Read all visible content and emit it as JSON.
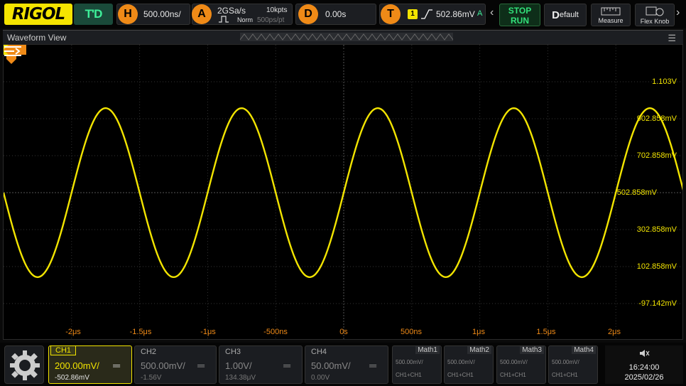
{
  "brand": {
    "logo": "RIGOL"
  },
  "toolbar": {
    "td_label": "T'D",
    "horizontal": {
      "icon": "H",
      "timebase": "500.00ns/"
    },
    "acquire": {
      "icon": "A",
      "sample_rate": "2GSa/s",
      "memory_depth": "10kpts",
      "mode": "Norm",
      "resolution": "500ps/pt"
    },
    "delay": {
      "icon": "D",
      "value": "0.00s"
    },
    "trigger": {
      "icon": "T",
      "source": "1",
      "level": "502.86mV",
      "status": "A"
    },
    "stop_label": "STOP",
    "run_label": "RUN",
    "default_label": "efault",
    "default_letter": "D",
    "measure_label": "Measure",
    "flex_label": "Flex Knob"
  },
  "waveform_view": {
    "title": "Waveform View",
    "trigger_marker": "T",
    "channel_marker": "1",
    "level_marker": "T",
    "y_labels": [
      "1.103V",
      "902.858mV",
      "702.858mV",
      "502.858mV",
      "302.858mV",
      "102.858mV",
      "-97.142mV"
    ],
    "x_labels": [
      "-2μs",
      "-1.5μs",
      "-1μs",
      "-500ns",
      "0s",
      "500ns",
      "1μs",
      "1.5μs",
      "2μs"
    ]
  },
  "chart_data": {
    "type": "line",
    "series": [
      {
        "name": "CH1",
        "color": "#f2e400",
        "amplitude_v": 0.4,
        "offset_v": 0.502858,
        "period_s": 1e-06
      }
    ],
    "x_range_s": [
      -2.5e-06,
      2.5e-06
    ],
    "y_range_v": [
      -0.197142,
      1.202858
    ],
    "grid": true
  },
  "channels": [
    {
      "name": "CH1",
      "scale": "200.00mV/",
      "offset": "-502.86mV",
      "active": true
    },
    {
      "name": "CH2",
      "scale": "500.00mV/",
      "offset": "-1.56V",
      "active": false
    },
    {
      "name": "CH3",
      "scale": "1.00V/",
      "offset": "134.38μV",
      "active": false
    },
    {
      "name": "CH4",
      "scale": "50.00mV/",
      "offset": "0.00V",
      "active": false
    }
  ],
  "maths": [
    {
      "name": "Math1",
      "scale": "500.00mV/",
      "expr": "CH1+CH1"
    },
    {
      "name": "Math2",
      "scale": "500.00mV/",
      "expr": "CH1+CH1"
    },
    {
      "name": "Math3",
      "scale": "500.00mV/",
      "expr": "CH1+CH1"
    },
    {
      "name": "Math4",
      "scale": "500.00mV/",
      "expr": "CH1+CH1"
    }
  ],
  "status": {
    "time": "16:24:00",
    "date": "2025/02/26"
  }
}
